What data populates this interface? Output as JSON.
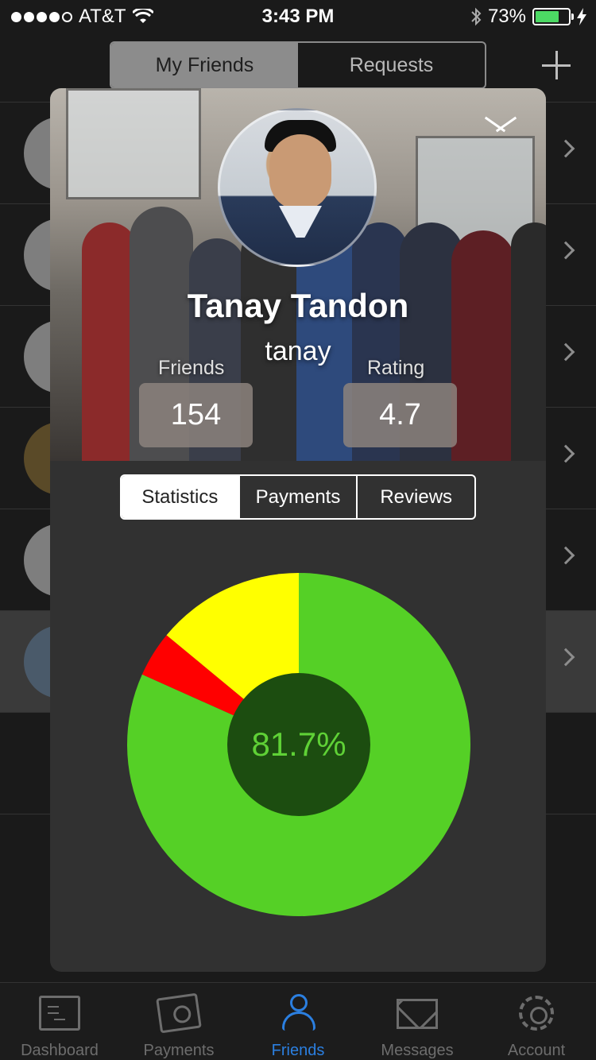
{
  "status_bar": {
    "carrier": "AT&T",
    "time": "3:43 PM",
    "battery": "73%",
    "battery_level": 0.73,
    "signal_bars": 4,
    "icons": [
      "wifi-icon",
      "bluetooth-icon",
      "charging-icon"
    ]
  },
  "top_tabs": [
    {
      "label": "My Friends",
      "active": true
    },
    {
      "label": "Requests",
      "active": false
    }
  ],
  "add_icon": "plus-icon",
  "profile": {
    "name": "Tanay Tandon",
    "username": "tanay",
    "friends_label": "Friends",
    "friends_count": "154",
    "rating_label": "Rating",
    "rating": "4.7",
    "collapse_icon": "chevron-down-icon"
  },
  "profile_tabs": [
    {
      "label": "Statistics",
      "active": true
    },
    {
      "label": "Payments",
      "active": false
    },
    {
      "label": "Reviews",
      "active": false
    }
  ],
  "chart_data": {
    "type": "pie",
    "variant": "donut",
    "center_label": "81.7%",
    "slices": [
      {
        "value": 81.7,
        "color": "#55d026"
      },
      {
        "value": 4.3,
        "color": "#ff0000"
      },
      {
        "value": 14.0,
        "color": "#ffff00"
      }
    ],
    "start_angle_deg": 0,
    "direction": "clockwise",
    "inner_color": "#1c4d10"
  },
  "tab_bar": [
    {
      "label": "Dashboard",
      "icon": "dashboard-icon",
      "active": false
    },
    {
      "label": "Payments",
      "icon": "payments-icon",
      "active": false
    },
    {
      "label": "Friends",
      "icon": "friends-icon",
      "active": true
    },
    {
      "label": "Messages",
      "icon": "messages-icon",
      "active": false
    },
    {
      "label": "Account",
      "icon": "gear-icon",
      "active": false
    }
  ],
  "colors": {
    "accent": "#2b7fe0",
    "background": "#1a1a1a",
    "card": "#313131"
  }
}
